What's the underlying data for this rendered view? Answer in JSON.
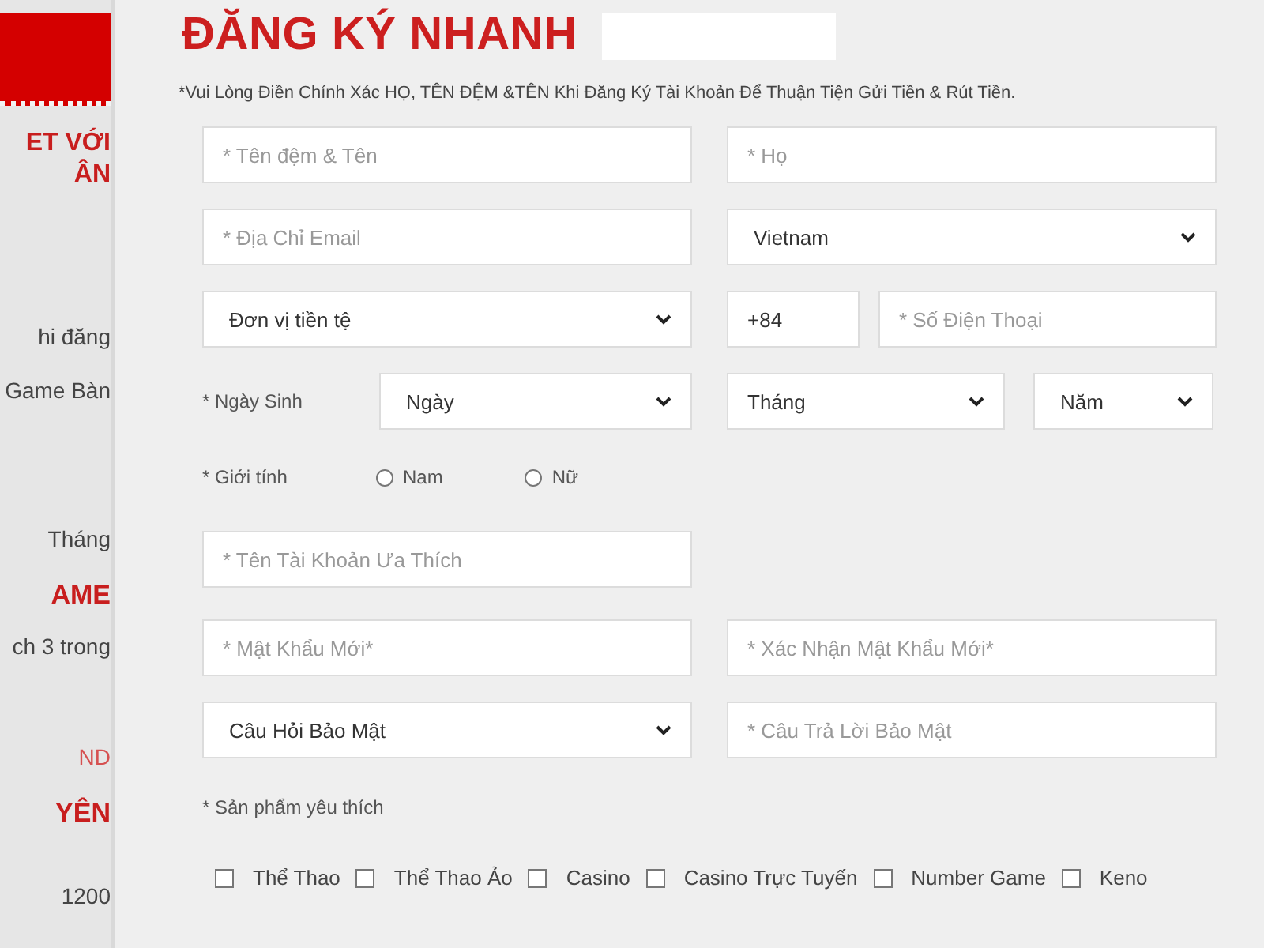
{
  "sidebar": {
    "heading_lines": [
      "ET VỚI",
      "ÂN"
    ],
    "items": [
      {
        "kind": "text",
        "text": "hi đăng"
      },
      {
        "kind": "text",
        "text": "Game Bàn"
      },
      {
        "kind": "text",
        "text": "Tháng"
      },
      {
        "kind": "heading",
        "text": "AME"
      },
      {
        "kind": "text",
        "text": "ch 3 trong"
      },
      {
        "kind": "subheading",
        "text": "ND"
      },
      {
        "kind": "heading",
        "text": "YÊN"
      },
      {
        "kind": "text",
        "text": "1200"
      }
    ]
  },
  "title": "ĐĂNG KÝ NHANH",
  "notice": "*Vui Lòng Điền Chính Xác HỌ, TÊN ĐỆM &TÊN Khi Đăng Ký Tài Khoản Để Thuận Tiện Gửi Tiền & Rút Tiền.",
  "fields": {
    "first_name": {
      "placeholder": "* Tên đệm & Tên"
    },
    "last_name": {
      "placeholder": "* Họ"
    },
    "email": {
      "placeholder": "* Địa Chỉ Email"
    },
    "country": {
      "value": "Vietnam"
    },
    "currency": {
      "value": "Đơn vị tiền tệ"
    },
    "phone_code": {
      "value": "+84"
    },
    "phone": {
      "placeholder": "* Số Điện Thoại"
    },
    "birthday": {
      "label": "* Ngày Sinh",
      "day": "Ngày",
      "month": "Tháng",
      "year": "Năm"
    },
    "gender": {
      "label": "* Giới tính",
      "options": [
        {
          "label": "Nam",
          "selected": false
        },
        {
          "label": "Nữ",
          "selected": false
        }
      ]
    },
    "username": {
      "placeholder": "* Tên Tài Khoản Ưa Thích"
    },
    "password": {
      "placeholder": "* Mật Khẩu Mới*"
    },
    "password_confirm": {
      "placeholder": "* Xác Nhận Mật Khẩu Mới*"
    },
    "security_question": {
      "value": "Câu Hỏi Bảo Mật"
    },
    "security_answer": {
      "placeholder": "* Câu Trả Lời Bảo Mật"
    }
  },
  "products": {
    "label": "* Sản phẩm yêu thích",
    "options": [
      {
        "label": "Thể Thao",
        "checked": false
      },
      {
        "label": "Thể Thao Ảo",
        "checked": false
      },
      {
        "label": "Casino",
        "checked": false
      },
      {
        "label": "Casino Trực Tuyến",
        "checked": false
      },
      {
        "label": "Number Game",
        "checked": false
      },
      {
        "label": "Keno",
        "checked": false
      }
    ]
  }
}
